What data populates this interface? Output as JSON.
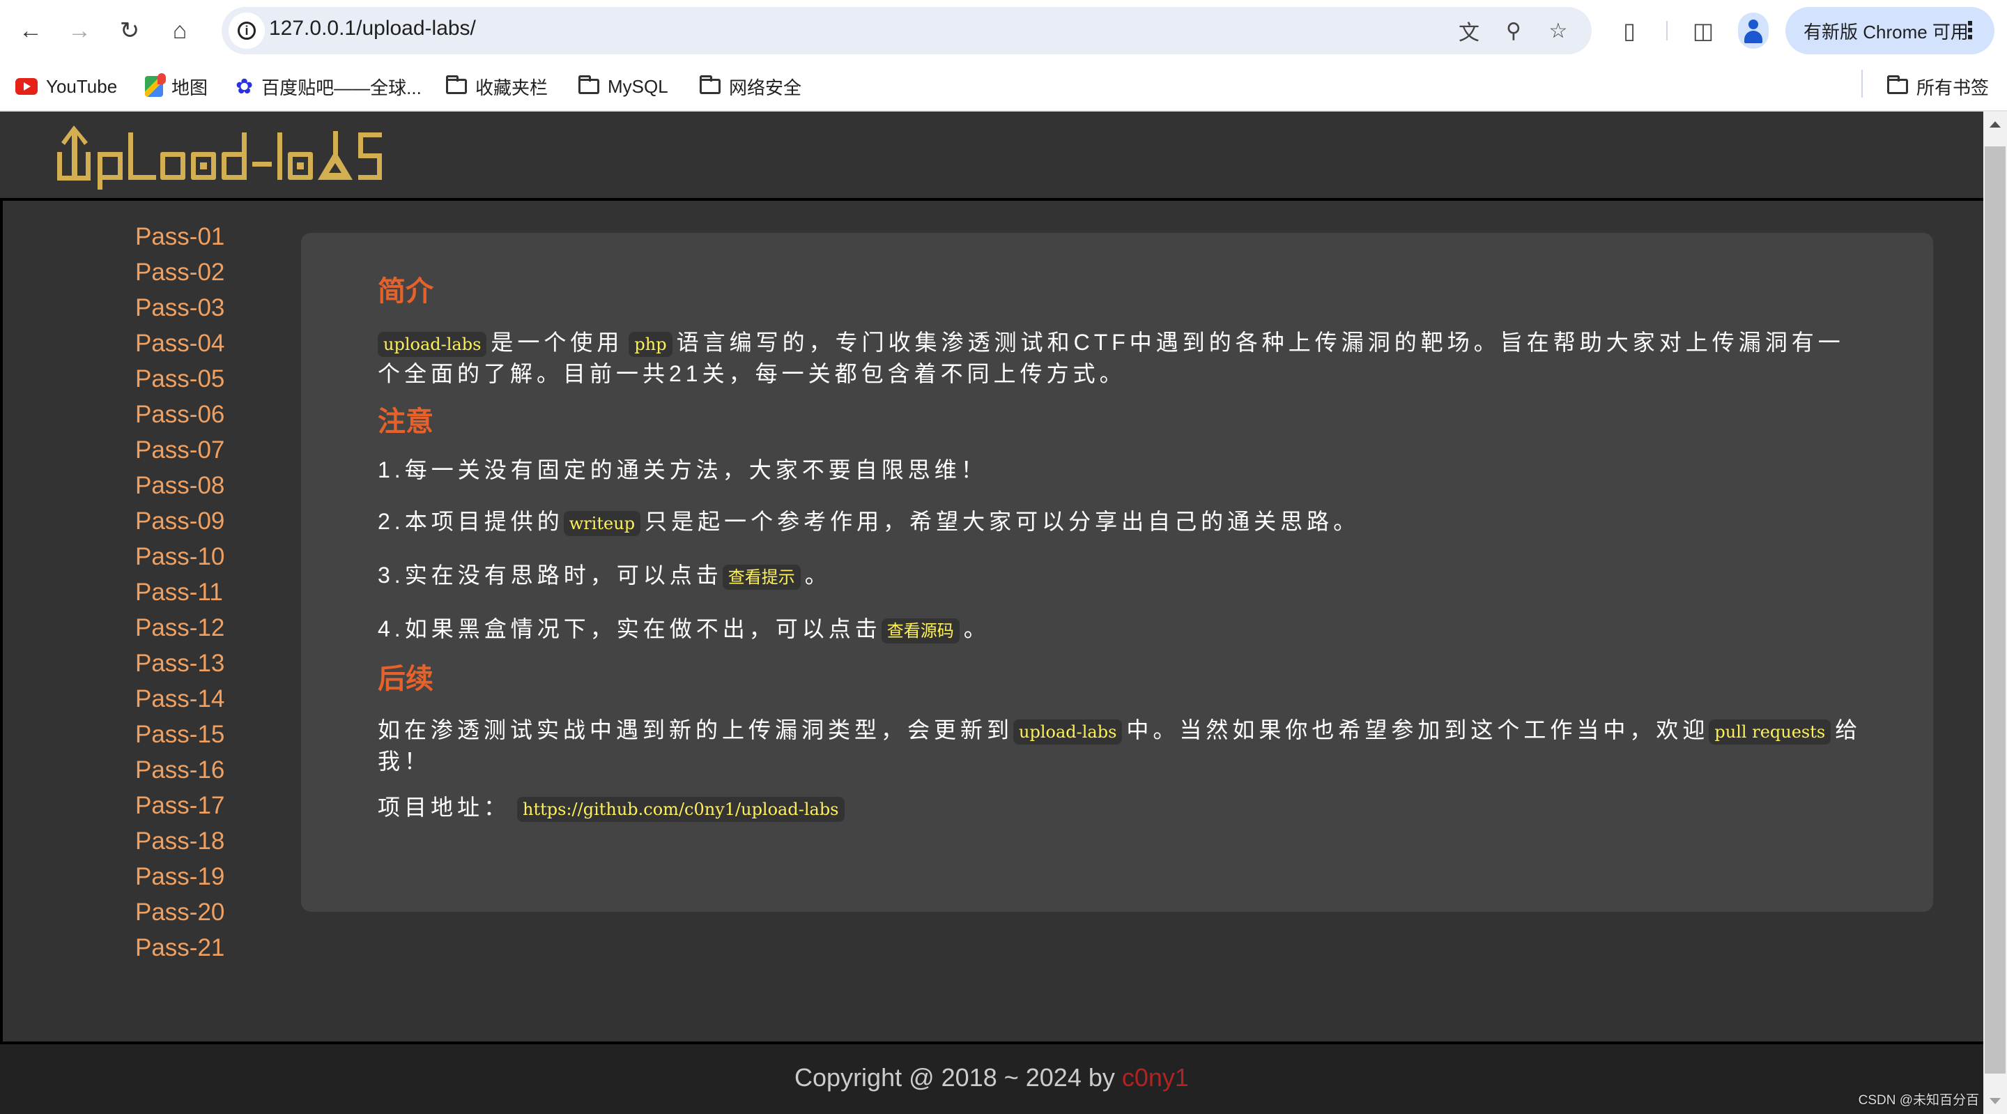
{
  "browser": {
    "url": "127.0.0.1/upload-labs/",
    "update_button": "有新版 Chrome 可用",
    "bookmarks": [
      {
        "label": "YouTube",
        "icon": "youtube-icon"
      },
      {
        "label": "地图",
        "icon": "maps-icon"
      },
      {
        "label": "百度贴吧——全球...",
        "icon": "baidu-icon"
      },
      {
        "label": "收藏夹栏",
        "icon": "folder-icon"
      },
      {
        "label": "MySQL",
        "icon": "folder-icon"
      },
      {
        "label": "网络安全",
        "icon": "folder-icon"
      }
    ],
    "all_bookmarks": "所有书签"
  },
  "header": {
    "logo_text": "UpLoad-labS",
    "logo_color": "#d4af52"
  },
  "sidebar": {
    "links": [
      "Pass-01",
      "Pass-02",
      "Pass-03",
      "Pass-04",
      "Pass-05",
      "Pass-06",
      "Pass-07",
      "Pass-08",
      "Pass-09",
      "Pass-10",
      "Pass-11",
      "Pass-12",
      "Pass-13",
      "Pass-14",
      "Pass-15",
      "Pass-16",
      "Pass-17",
      "Pass-18",
      "Pass-19",
      "Pass-20",
      "Pass-21"
    ],
    "link_color": "#f0a060"
  },
  "content": {
    "intro": {
      "title": "简介",
      "code1": "upload-labs",
      "text1": "是一个使用",
      "code2": "php",
      "text2": "语言编写的，专门收集渗透测试和CTF中遇到的各种上传漏洞的靶场。旨在帮助大家对上传漏洞有一个全面的了解。目前一共21关，每一关都包含着不同上传方式。"
    },
    "notes": {
      "title": "注意",
      "item1": "1.每一关没有固定的通关方法，大家不要自限思维！",
      "item2_pre": "2.本项目提供的",
      "item2_code": "writeup",
      "item2_post": "只是起一个参考作用，希望大家可以分享出自己的通关思路。",
      "item3_pre": "3.实在没有思路时，可以点击",
      "item3_code": "查看提示",
      "item3_post": "。",
      "item4_pre": "4.如果黑盒情况下，实在做不出，可以点击",
      "item4_code": "查看源码",
      "item4_post": "。"
    },
    "followup": {
      "title": "后续",
      "text1": "如在渗透测试实战中遇到新的上传漏洞类型，会更新到",
      "code1": "upload-labs",
      "text2": "中。当然如果你也希望参加到这个工作当中，欢迎",
      "code2": "pull requests",
      "text3": "给我！",
      "address_label": "项目地址：",
      "address_link": "https://github.com/c0ny1/upload-labs"
    },
    "title_color": "#e6622a",
    "code_color": "#fdf05a"
  },
  "footer": {
    "copyright": "Copyright @ 2018 ~ 2024 by",
    "author": "c0ny1",
    "author_color": "#b22222"
  },
  "watermark": "CSDN @未知百分百"
}
